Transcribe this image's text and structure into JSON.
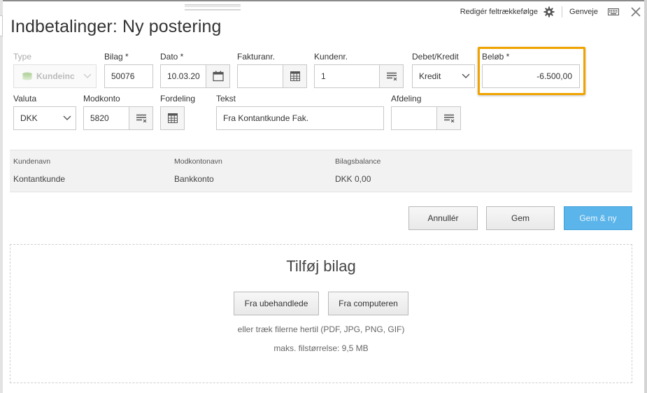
{
  "header": {
    "edit_order_link": "Redigér feltrækkefølge",
    "shortcuts_link": "Genveje",
    "title": "Indbetalinger: Ny postering"
  },
  "form": {
    "type": {
      "label": "Type",
      "value": "Kundeinc"
    },
    "bilag": {
      "label": "Bilag *",
      "value": "50076"
    },
    "dato": {
      "label": "Dato *",
      "value": "10.03.20"
    },
    "fakturanr": {
      "label": "Fakturanr.",
      "value": ""
    },
    "kundenr": {
      "label": "Kundenr.",
      "value": "1"
    },
    "debet_kredit": {
      "label": "Debet/Kredit",
      "value": "Kredit"
    },
    "beloeb": {
      "label": "Beløb *",
      "value": "-6.500,00"
    },
    "valuta": {
      "label": "Valuta",
      "value": "DKK"
    },
    "modkonto": {
      "label": "Modkonto",
      "value": "5820"
    },
    "fordeling": {
      "label": "Fordeling"
    },
    "tekst": {
      "label": "Tekst",
      "value": "Fra Kontantkunde Fak."
    },
    "afdeling": {
      "label": "Afdeling",
      "value": ""
    }
  },
  "info": {
    "kundenavn": {
      "label": "Kundenavn",
      "value": "Kontantkunde"
    },
    "modkontonavn": {
      "label": "Modkontonavn",
      "value": "Bankkonto"
    },
    "bilagsbalance": {
      "label": "Bilagsbalance",
      "value": "DKK 0,00"
    }
  },
  "actions": {
    "cancel": "Annullér",
    "save": "Gem",
    "save_new": "Gem & ny"
  },
  "attachment": {
    "title": "Tilføj bilag",
    "from_unprocessed": "Fra ubehandlede",
    "from_computer": "Fra computeren",
    "drag_hint": "eller træk filerne hertil (PDF, JPG, PNG, GIF)",
    "max_size": "maks. filstørrelse: 9,5 MB"
  },
  "colors": {
    "highlight": "#f0a300",
    "primary_button": "#5bb5ea"
  },
  "icons": [
    "gear-icon",
    "keyboard-icon",
    "close-icon",
    "calendar-icon",
    "grid-icon",
    "list-icon",
    "chevron-down-icon",
    "coin-icon"
  ]
}
